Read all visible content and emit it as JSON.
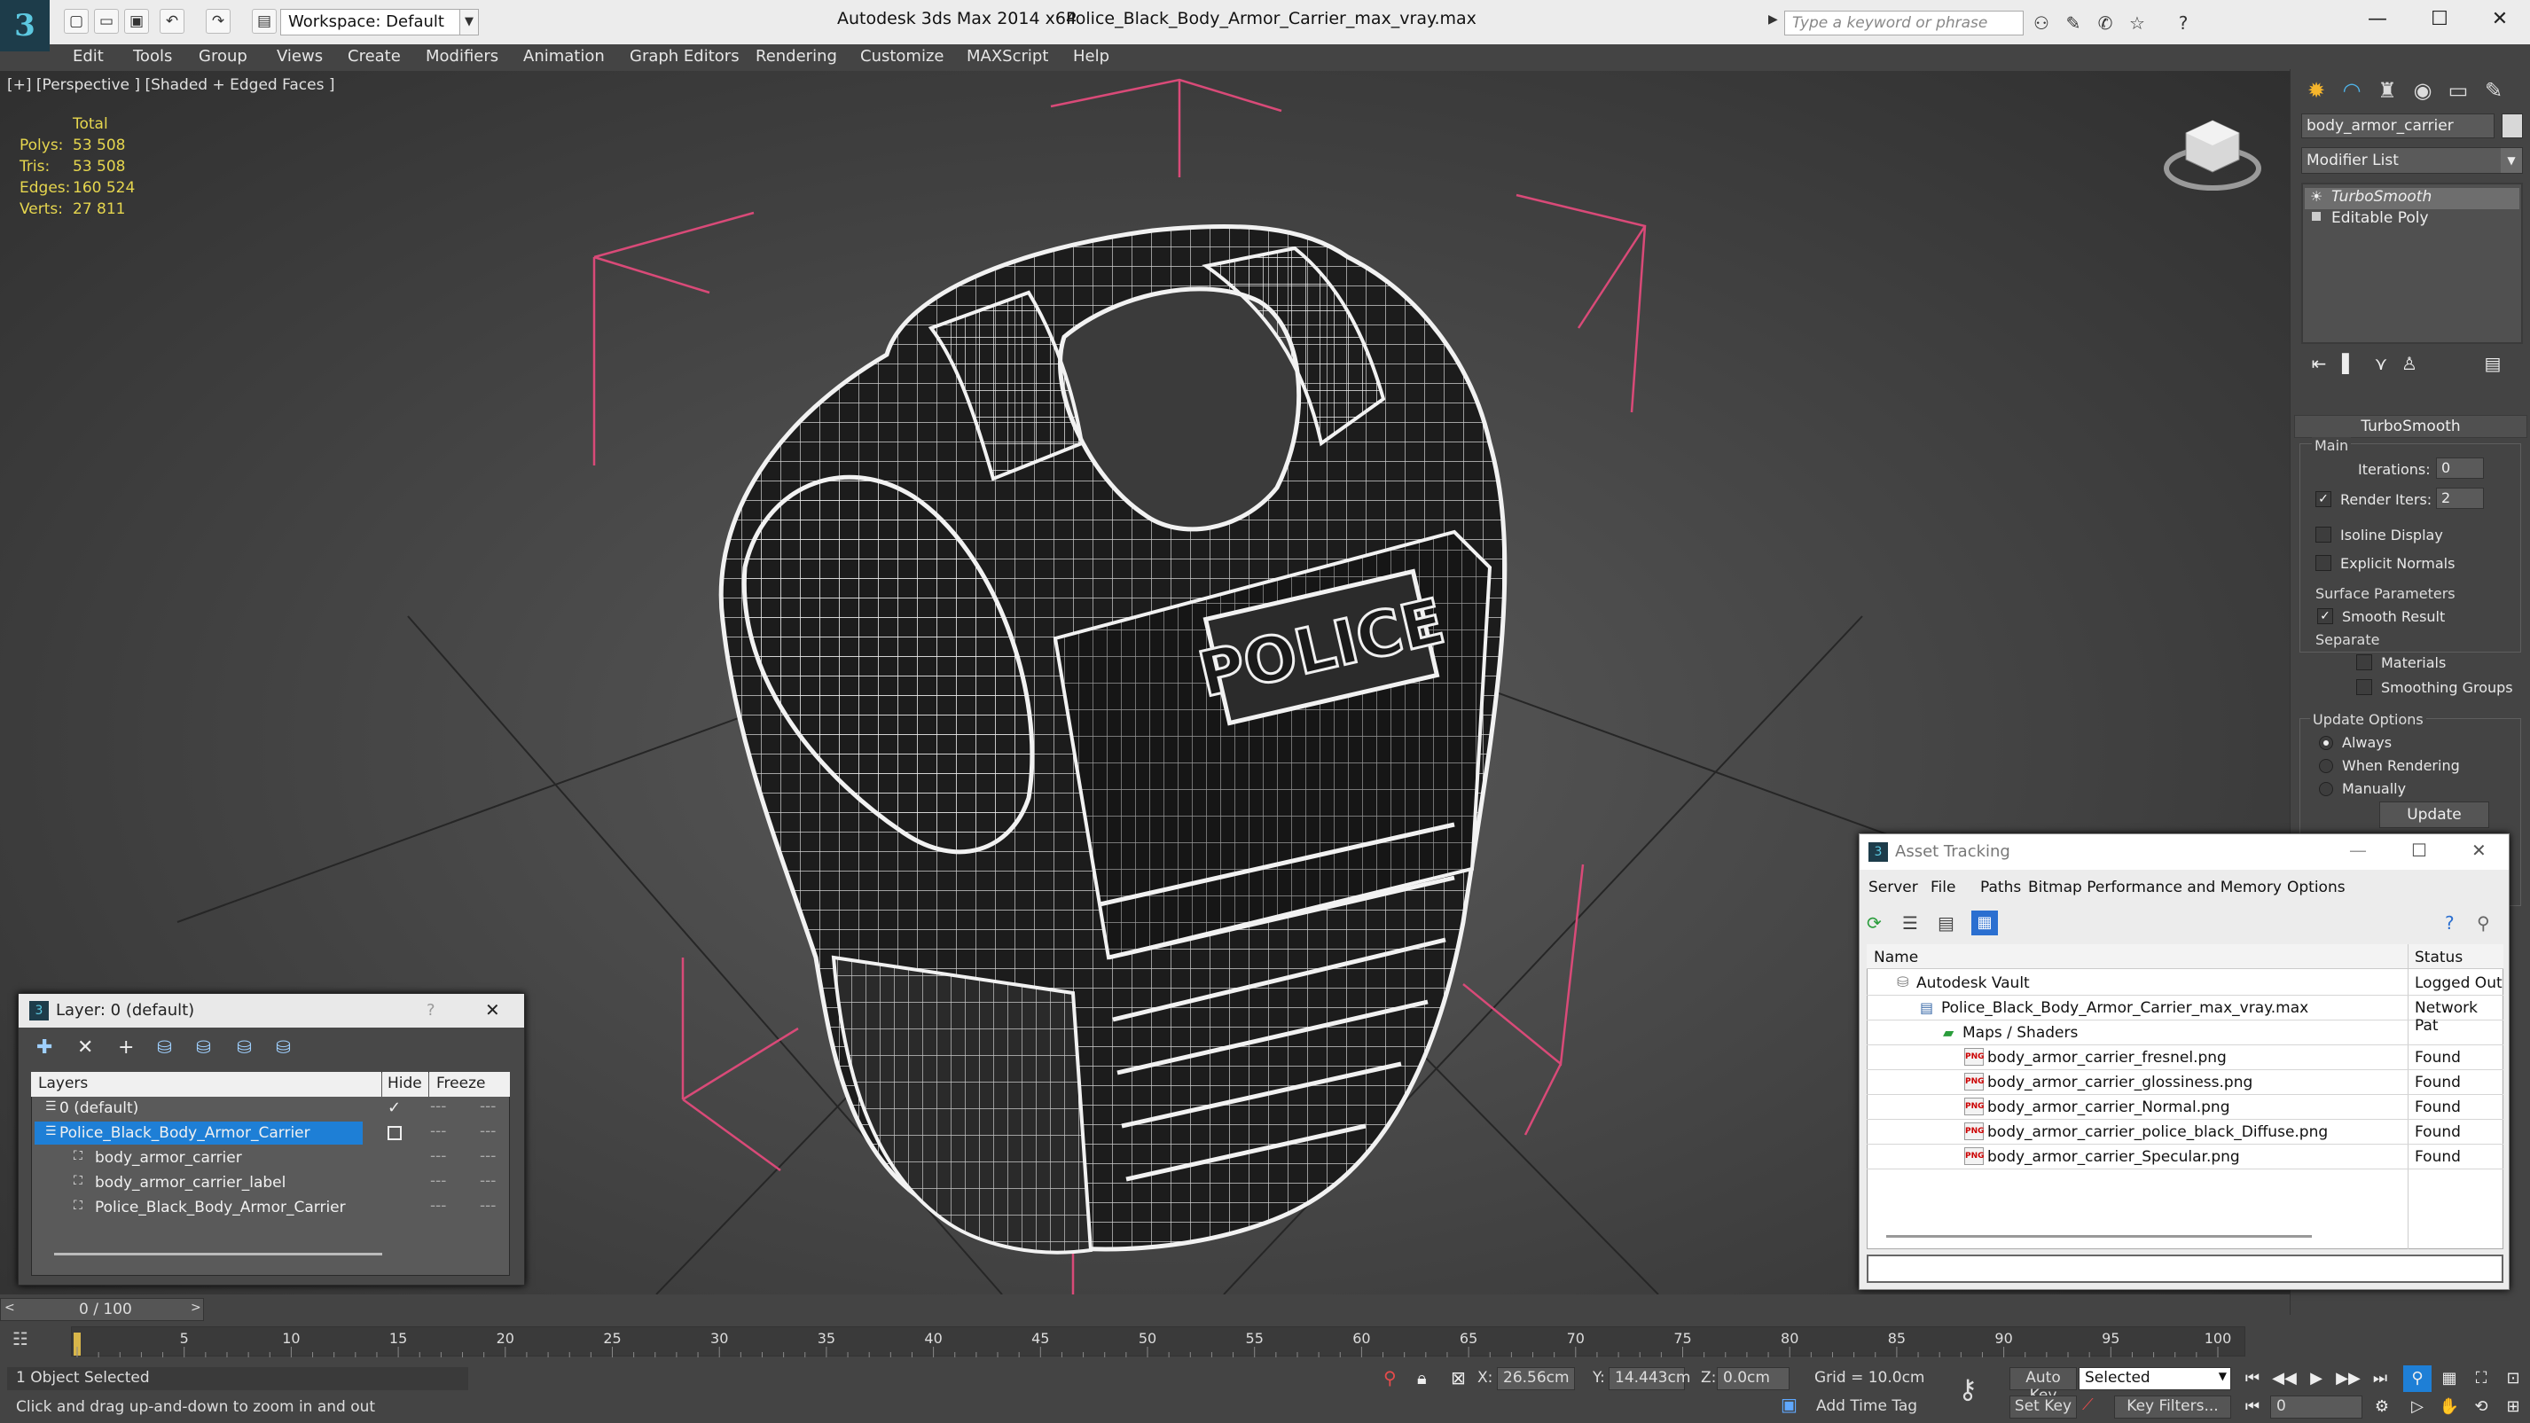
{
  "titlebar": {
    "workspace": "Workspace: Default",
    "app_title": "Autodesk 3ds Max  2014 x64",
    "file_title": "Police_Black_Body_Armor_Carrier_max_vray.max",
    "search_placeholder": "Type a keyword or phrase"
  },
  "menu": [
    "Edit",
    "Tools",
    "Group",
    "Views",
    "Create",
    "Modifiers",
    "Animation",
    "Graph Editors",
    "Rendering",
    "Customize",
    "MAXScript",
    "Help"
  ],
  "viewport": {
    "label": "[+] [Perspective ] [Shaded + Edged Faces ]",
    "stats_header": "Total",
    "stats": [
      {
        "label": "Polys:",
        "value": "53 508"
      },
      {
        "label": "Tris:",
        "value": "53 508"
      },
      {
        "label": "Edges:",
        "value": "160 524"
      },
      {
        "label": "Verts:",
        "value": "27 811"
      }
    ],
    "model_text": "POLICE"
  },
  "command_panel": {
    "object_name": "body_armor_carrier",
    "modifier_list": "Modifier List",
    "stack": [
      "TurboSmooth",
      "Editable Poly"
    ],
    "rollout_title": "TurboSmooth",
    "main_label": "Main",
    "iterations_label": "Iterations:",
    "iterations_value": "0",
    "render_iters_label": "Render Iters:",
    "render_iters_value": "2",
    "isoline": "Isoline Display",
    "explicit_normals": "Explicit Normals",
    "surface_params": "Surface Parameters",
    "smooth_result": "Smooth Result",
    "separate": "Separate",
    "materials": "Materials",
    "smoothing_groups": "Smoothing Groups",
    "update_options": "Update Options",
    "always": "Always",
    "when_rendering": "When Rendering",
    "manually": "Manually",
    "update_button": "Update"
  },
  "layer_dialog": {
    "title": "Layer: 0 (default)",
    "help": "?",
    "col_layers": "Layers",
    "col_hide": "Hide",
    "col_freeze": "Freeze",
    "rows": [
      {
        "name": "0 (default)",
        "indent": 1
      },
      {
        "name": "Police_Black_Body_Armor_Carrier",
        "indent": 1,
        "selected": true
      },
      {
        "name": "body_armor_carrier",
        "indent": 2
      },
      {
        "name": "body_armor_carrier_label",
        "indent": 2
      },
      {
        "name": "Police_Black_Body_Armor_Carrier",
        "indent": 2
      }
    ]
  },
  "asset_dialog": {
    "title": "Asset Tracking",
    "menu": [
      "Server",
      "File",
      "Paths",
      "Bitmap Performance and Memory",
      "Options"
    ],
    "col_name": "Name",
    "col_status": "Status",
    "rows": [
      {
        "name": "Autodesk Vault",
        "status": "Logged Out",
        "indent": 1
      },
      {
        "name": "Police_Black_Body_Armor_Carrier_max_vray.max",
        "status": "Network Pat",
        "indent": 2
      },
      {
        "name": "Maps / Shaders",
        "status": "",
        "indent": 3
      },
      {
        "name": "body_armor_carrier_fresnel.png",
        "status": "Found",
        "indent": 4
      },
      {
        "name": "body_armor_carrier_glossiness.png",
        "status": "Found",
        "indent": 4
      },
      {
        "name": "body_armor_carrier_Normal.png",
        "status": "Found",
        "indent": 4
      },
      {
        "name": "body_armor_carrier_police_black_Diffuse.png",
        "status": "Found",
        "indent": 4
      },
      {
        "name": "body_armor_carrier_Specular.png",
        "status": "Found",
        "indent": 4
      }
    ]
  },
  "timeline": {
    "frame": "0 / 100",
    "ticks": [
      "0",
      "5",
      "10",
      "15",
      "20",
      "25",
      "30",
      "35",
      "40",
      "45",
      "50",
      "55",
      "60",
      "65",
      "70",
      "75",
      "80",
      "85",
      "90",
      "95",
      "100"
    ]
  },
  "status": {
    "selection": "1 Object Selected",
    "prompt": "Click and drag up-and-down to zoom in and out",
    "x_label": "X:",
    "x_value": "26.56cm",
    "y_label": "Y:",
    "y_value": "14.443cm",
    "z_label": "Z:",
    "z_value": "0.0cm",
    "grid": "Grid = 10.0cm",
    "add_time_tag": "Add Time Tag",
    "auto_key": "Auto Key",
    "set_key": "Set Key",
    "selected": "Selected",
    "key_filters": "Key Filters...",
    "frame_value": "0"
  },
  "colors": {
    "accent": "#1e7fd6",
    "stat": "#e6d64e",
    "gizmo": "#d94a78",
    "wire": "#f2f2f2"
  }
}
